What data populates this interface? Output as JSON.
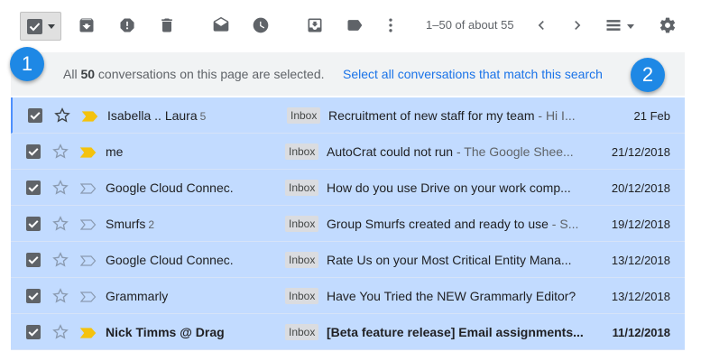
{
  "toolbar": {
    "pagination": "1–50 of about 55",
    "icons": [
      "select-all-checkbox",
      "archive-icon",
      "report-spam-icon",
      "delete-icon",
      "mark-read-icon",
      "snooze-icon",
      "move-to-icon",
      "label-icon",
      "more-icon",
      "prev-page-icon",
      "next-page-icon",
      "density-icon",
      "settings-icon"
    ]
  },
  "banner": {
    "prefix": "All ",
    "count": "50",
    "suffix": " conversations on this page are selected.",
    "link": "Select all conversations that match this search"
  },
  "badges": [
    "1",
    "2"
  ],
  "colors": {
    "selected_row": "#c2dbff",
    "link": "#1a73e8",
    "badge": "#1e88e5",
    "important_marker": "#f4c20d"
  },
  "rows": [
    {
      "sender": "Isabella .. Laura",
      "count": "5",
      "label": "Inbox",
      "subject": "Recruitment of new staff for my team",
      "snippet": " - Hi I...",
      "date": "21 Feb",
      "important": true,
      "unread": false
    },
    {
      "sender": "me",
      "count": "",
      "label": "Inbox",
      "subject": "AutoCrat could not run",
      "snippet": " - The Google Shee...",
      "date": "21/12/2018",
      "important": true,
      "unread": false
    },
    {
      "sender": "Google Cloud Connec.",
      "count": "",
      "label": "Inbox",
      "subject": "How do you use Drive on your work comp...",
      "snippet": "",
      "date": "20/12/2018",
      "important": false,
      "unread": false
    },
    {
      "sender": "Smurfs",
      "count": "2",
      "label": "Inbox",
      "subject": "Group Smurfs created and ready to use",
      "snippet": " - S...",
      "date": "19/12/2018",
      "important": false,
      "unread": false
    },
    {
      "sender": "Google Cloud Connec.",
      "count": "",
      "label": "Inbox",
      "subject": "Rate Us on your Most Critical Entity Mana...",
      "snippet": "",
      "date": "13/12/2018",
      "important": false,
      "unread": false
    },
    {
      "sender": "Grammarly",
      "count": "",
      "label": "Inbox",
      "subject": "Have You Tried the NEW Grammarly Editor?",
      "snippet": "",
      "date": "13/12/2018",
      "important": false,
      "unread": false
    },
    {
      "sender": "Nick Timms @ Drag",
      "count": "",
      "label": "Inbox",
      "subject": "[Beta feature release] Email assignments...",
      "snippet": "",
      "date": "11/12/2018",
      "important": true,
      "unread": true
    }
  ]
}
